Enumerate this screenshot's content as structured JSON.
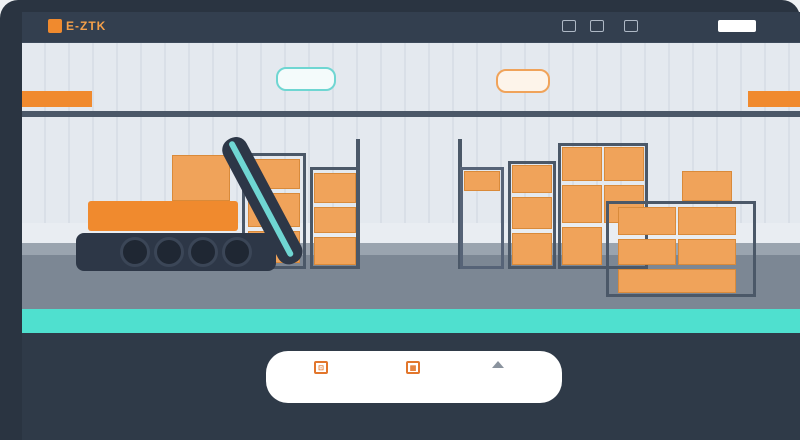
{
  "header": {
    "logo_text": "E-ZTK",
    "nav": [
      "",
      "",
      "",
      "",
      "",
      "",
      ""
    ],
    "icons": [
      "window-icon",
      "tablet-icon",
      "settings-icon"
    ]
  },
  "hero": {
    "bubble_left": "",
    "bubble_right": ""
  },
  "strip": {
    "items": [
      "",
      "",
      "",
      ""
    ]
  },
  "panel": {
    "items": [
      {
        "icon": "document-icon",
        "label": ""
      },
      {
        "icon": "calendar-icon",
        "label": ""
      },
      {
        "icon": "warning-icon",
        "label": ""
      }
    ]
  },
  "colors": {
    "accent": "#f08a2e",
    "teal": "#4fe0cf",
    "dark": "#2f3a48"
  }
}
